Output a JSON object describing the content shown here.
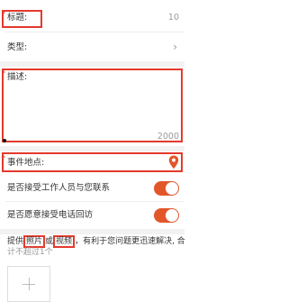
{
  "form": {
    "title_field": {
      "required_mark": "*",
      "label": "标题:",
      "counter": "10"
    },
    "type_field": {
      "label": "类型:",
      "chevron": "›"
    },
    "description_field": {
      "required_mark": "*",
      "label": "描述:",
      "counter": "2000"
    },
    "location_field": {
      "required_mark": "*",
      "label": "事件地点:",
      "icon": "location-pin-icon"
    },
    "contact_toggle": {
      "label": "是否接受工作人员与您联系",
      "on": true
    },
    "callback_toggle": {
      "label": "是否愿意接受电话回访",
      "on": true
    },
    "media_hint": {
      "prefix": "提供",
      "photo": "照片",
      "or": "或",
      "video": "视频",
      "suffix": "，有利于您问题更迅速解决, 合",
      "line2": "计不超过1个"
    }
  },
  "colors": {
    "accent": "#e2572a",
    "highlight_box": "#e33a2c",
    "divider": "#f2f2f2"
  }
}
